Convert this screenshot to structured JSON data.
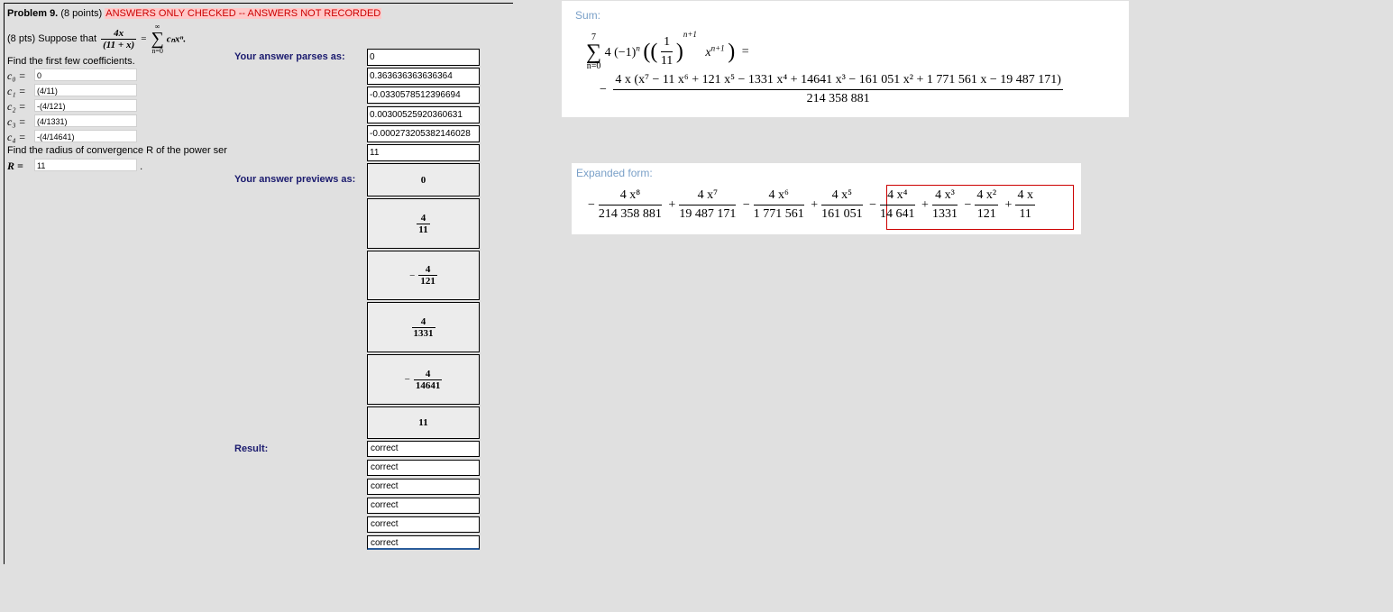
{
  "problem": {
    "number_label": "Problem 9.",
    "points": "(8 points)",
    "status": "ANSWERS ONLY CHECKED -- ANSWERS NOT RECORDED",
    "prefix": "(8 pts) Suppose that",
    "frac_num": "4x",
    "frac_den": "(11 + x)",
    "equals": "=",
    "sum_top": "∞",
    "sum_bottom": "n=0",
    "sum_term": "cₙxⁿ.",
    "find_coef": "Find the first few coefficients.",
    "find_radius": "Find the radius of convergence R of the power ser"
  },
  "coefficients": [
    {
      "label": "c₀ =",
      "value": "0"
    },
    {
      "label": "c₁ =",
      "value": "(4/11)"
    },
    {
      "label": "c₂ =",
      "value": "-(4/121)"
    },
    {
      "label": "c₃ =",
      "value": "(4/1331)"
    },
    {
      "label": "c₄ =",
      "value": "-(4/14641)"
    }
  ],
  "radius": {
    "label": "R =",
    "value": "11",
    "trailing": "."
  },
  "labels": {
    "parses": "Your answer parses as:",
    "previews": "Your answer previews as:",
    "result": "Result:"
  },
  "parsed": [
    "0",
    "0.363636363636364",
    "-0.0330578512396694",
    "0.00300525920360631",
    "-0.000273205382146028",
    "11"
  ],
  "previews": [
    {
      "sign": "",
      "num": "",
      "den": "",
      "whole": "0"
    },
    {
      "sign": "",
      "num": "4",
      "den": "11",
      "whole": ""
    },
    {
      "sign": "−",
      "num": "4",
      "den": "121",
      "whole": ""
    },
    {
      "sign": "",
      "num": "4",
      "den": "1331",
      "whole": ""
    },
    {
      "sign": "−",
      "num": "4",
      "den": "14641",
      "whole": ""
    },
    {
      "sign": "",
      "num": "",
      "den": "",
      "whole": "11"
    }
  ],
  "results": [
    "correct",
    "correct",
    "correct",
    "correct",
    "correct",
    "correct"
  ],
  "sum_card": {
    "title": "Sum:",
    "upper": "7",
    "lower": "n=0",
    "expr_a": "4 (−1)",
    "expr_a_sup": "n",
    "inner_num": "1",
    "inner_den": "11",
    "inner_sup": "n+1",
    "expr_x": "x",
    "expr_x_sup": "n+1",
    "equals": "=",
    "result_sign": "−",
    "result_num": "4 x (x⁷ − 11 x⁶ + 121 x⁵ − 1331 x⁴ + 14641 x³ − 161 051 x² + 1 771 561 x − 19 487 171)",
    "result_den": "214 358 881"
  },
  "expanded_card": {
    "title": "Expanded form:",
    "terms": [
      {
        "op": "−",
        "num": "4 x⁸",
        "den": "214 358 881"
      },
      {
        "op": "+",
        "num": "4 x⁷",
        "den": "19 487 171"
      },
      {
        "op": "−",
        "num": "4 x⁶",
        "den": "1 771 561"
      },
      {
        "op": "+",
        "num": "4 x⁵",
        "den": "161 051"
      },
      {
        "op": "−",
        "num": "4 x⁴",
        "den": "14 641"
      },
      {
        "op": "+",
        "num": "4 x³",
        "den": "1331"
      },
      {
        "op": "−",
        "num": "4 x²",
        "den": "121"
      },
      {
        "op": "+",
        "num": "4 x",
        "den": "11"
      }
    ]
  },
  "colors": {
    "warning_bg": "#ffc8c8",
    "warning_text": "#cc0000",
    "label_navy": "#1a1a6e",
    "card_title": "#7aa0c8",
    "highlight_border": "#cc0000"
  }
}
